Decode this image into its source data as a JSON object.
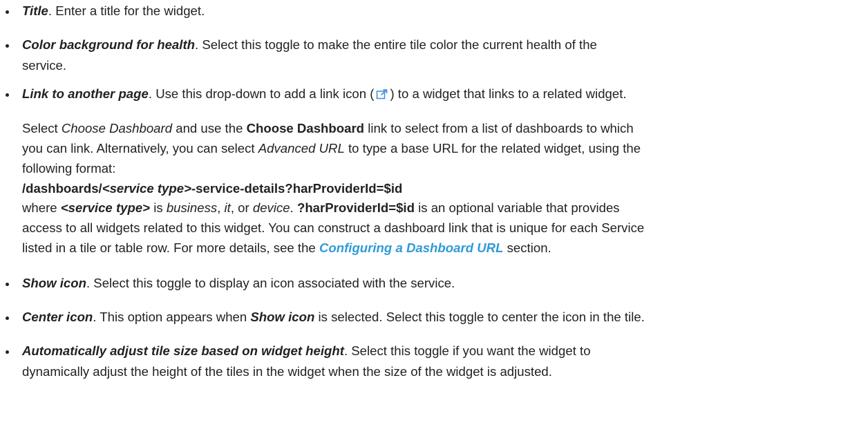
{
  "bullets": [
    {
      "term": "Title",
      "text": ". Enter a title for the widget."
    },
    {
      "term": "Color background for health",
      "line1": ". Select this toggle to make the entire tile color the current health of the",
      "line2": "service."
    },
    {
      "term": "Link to another page",
      "before_icon": ". Use this drop-down to add a link icon (",
      "after_icon": ") to a widget that links to a related widget.",
      "icon": "external-link-icon"
    },
    {
      "term": "Show icon",
      "text": ". Select this toggle to display an icon associated with the service."
    },
    {
      "term": "Center icon",
      "text_a": ". This option appears when ",
      "ref": "Show icon",
      "text_b": " is selected. Select this toggle to center the icon in the tile."
    },
    {
      "term": "Automatically adjust tile size based on widget height",
      "line1": ". Select this toggle if you want the widget to",
      "line2": "dynamically adjust the height of the tiles in the widget when the size of the widget is adjusted."
    }
  ],
  "para": {
    "p1_a": "Select ",
    "p1_choose_it": "Choose Dashboard",
    "p1_b": " and use the ",
    "p1_choose_bold": "Choose Dashboard",
    "p1_c": " link to select from a list of dashboards to which",
    "p2_a": "you can link. Alternatively, you can select ",
    "p2_adv": "Advanced URL",
    "p2_b": " to type a base URL for the related widget, using the",
    "p3": "following format:",
    "fmt_a": "/dashboards/",
    "fmt_st": "<service type>",
    "fmt_b": "-service-details?harProviderId=$id",
    "w_a": "where ",
    "w_st": "<service type>",
    "w_b": " is ",
    "w_business": "business",
    "w_c": ", ",
    "w_it": "it",
    "w_d": ", or ",
    "w_device": "device",
    "w_e": ". ",
    "w_var": "?harProviderId=$id",
    "w_f": " is an optional variable that provides",
    "l6": "access to all widgets related to this widget. You can construct a dashboard link that is unique for each Service",
    "l7_a": "listed in a tile or table row. For more details, see the ",
    "l7_link": "Configuring a Dashboard URL",
    "l7_b": " section."
  },
  "colors": {
    "link": "#2f9bd8",
    "icon": "#4a90d9",
    "text": "#222222"
  }
}
